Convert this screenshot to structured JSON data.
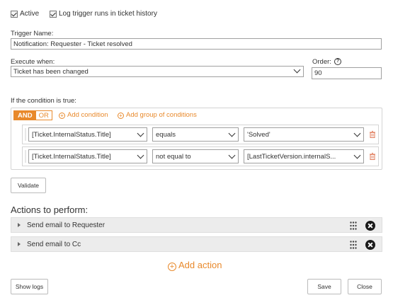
{
  "options": {
    "active_label": "Active",
    "log_label": "Log trigger runs in ticket history"
  },
  "trigger": {
    "name_label": "Trigger Name:",
    "name_value": "Notification: Requester - Ticket resolved",
    "execute_label": "Execute when:",
    "execute_value": "Ticket has been changed",
    "order_label": "Order:",
    "order_value": "90"
  },
  "conditions": {
    "heading": "If the condition is true:",
    "and_label": "AND",
    "or_label": "OR",
    "add_condition": "Add condition",
    "add_group": "Add group of conditions",
    "rows": [
      {
        "field": "[Ticket.InternalStatus.Title]",
        "operator": "equals",
        "value": "'Solved'"
      },
      {
        "field": "[Ticket.InternalStatus.Title]",
        "operator": "not equal to",
        "value": "[LastTicketVersion.internalS..."
      }
    ],
    "validate_label": "Validate"
  },
  "actions": {
    "heading": "Actions to perform:",
    "items": [
      {
        "label": "Send email to Requester"
      },
      {
        "label": "Send email to Cc"
      }
    ],
    "add_action": "Add action"
  },
  "footer": {
    "show_logs": "Show logs",
    "save": "Save",
    "close": "Close"
  },
  "colors": {
    "accent": "#e8892b",
    "row_bg": "#ececec"
  }
}
